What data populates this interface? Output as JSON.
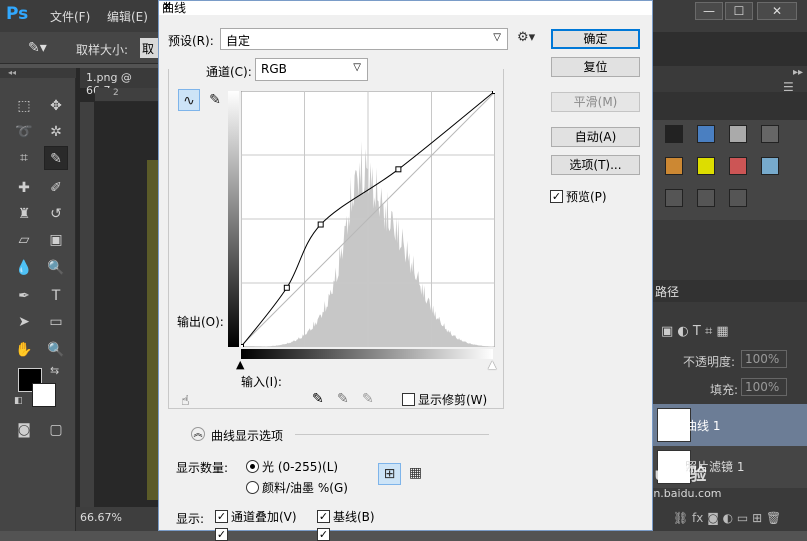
{
  "app": {
    "logo": "Ps",
    "menu": [
      "文件(F)",
      "编辑(E)"
    ],
    "window_buttons": [
      "—",
      "☐",
      "✕"
    ]
  },
  "options_bar": {
    "sample_size_label": "取样大小:",
    "sample_size_value": "取"
  },
  "document": {
    "tab_label": "1.png @ 66.7",
    "zoom": "66.67%",
    "ruler_mark": "2"
  },
  "colors": {
    "accent": "#0078d7",
    "dialog_bg": "#f0f0f0",
    "ps_panel": "#3a3a3a",
    "histogram": "#c7c7c7",
    "layer_selected": "#6c7d96"
  },
  "dialog": {
    "title": "曲线",
    "close": "✕",
    "preset_label": "预设(R):",
    "preset_value": "自定",
    "channel_label": "通道(C):",
    "channel_value": "RGB",
    "buttons": {
      "ok": "确定",
      "reset": "复位",
      "smooth": "平滑(M)",
      "auto": "自动(A)",
      "options": "选项(T)..."
    },
    "preview_label": "预览(P)",
    "preview_checked": true,
    "output_label": "输出(O):",
    "input_label": "输入(I):",
    "show_clipping_label": "显示修剪(W)",
    "curve_display_options_label": "曲线显示选项",
    "show_amount_label": "显示数量:",
    "light_label": "光 (0-255)(L)",
    "pigment_label": "颜料/油墨 %(G)",
    "show_label": "显示:",
    "channel_overlay_label": "通道叠加(V)",
    "baseline_label": "基线(B)",
    "curve_points": [
      [
        0,
        0
      ],
      [
        46,
        59
      ],
      [
        80,
        122
      ],
      [
        158,
        177
      ],
      [
        255,
        255
      ]
    ]
  },
  "layers": {
    "tab_label": "路径",
    "opacity_label": "不透明度:",
    "opacity_value": "100%",
    "fill_label": "填充:",
    "fill_value": "100%",
    "items": [
      {
        "name": "曲线 1"
      },
      {
        "name": "照片滤镜 1"
      }
    ]
  },
  "watermark": "jingyan.baidu.com"
}
